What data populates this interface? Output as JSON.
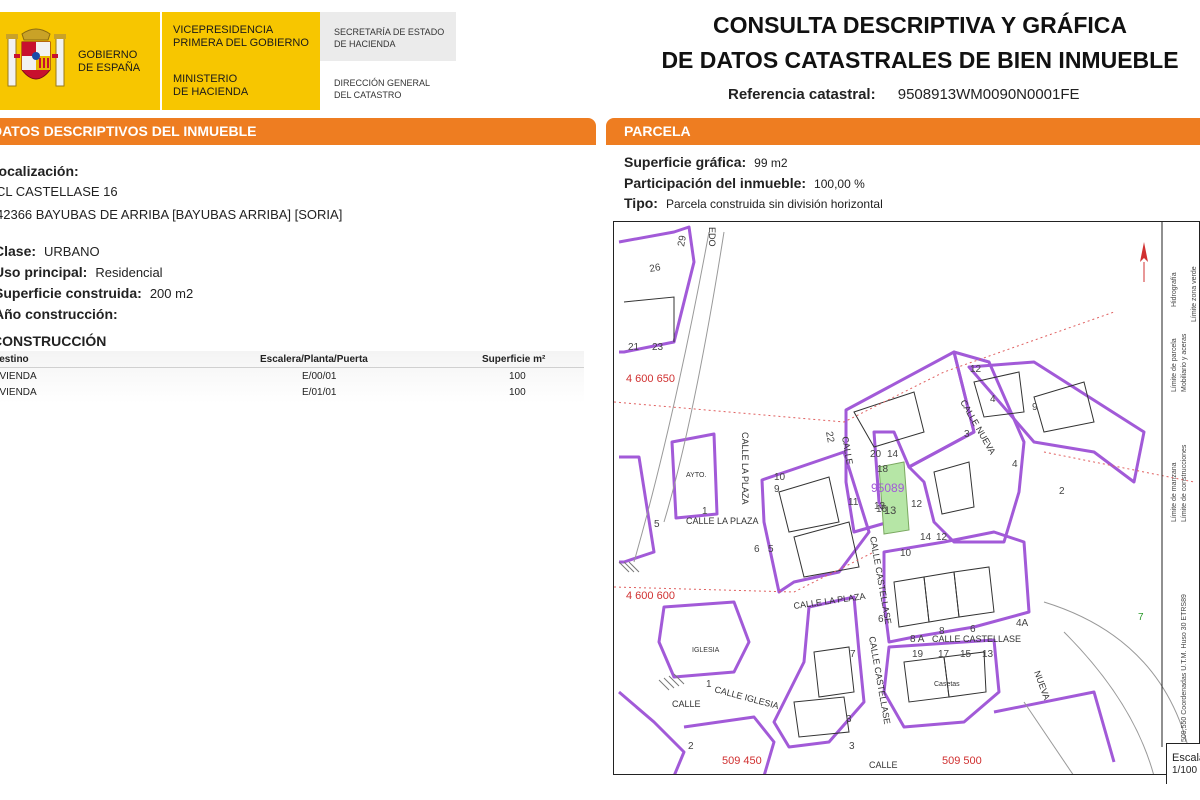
{
  "header": {
    "gobierno": "GOBIERNO\nDE ESPAÑA",
    "vicepresidencia": "VICEPRESIDENCIA\nPRIMERA DEL GOBIERNO",
    "ministerio": "MINISTERIO\nDE HACIENDA",
    "secretaria": "SECRETARÍA DE ESTADO\nDE HACIENDA",
    "direccion": "DIRECCIÓN GENERAL\nDEL CATASTRO",
    "title_line1": "CONSULTA DESCRIPTIVA Y GRÁFICA",
    "title_line2": "DE DATOS CATASTRALES DE BIEN INMUEBLE",
    "ref_label": "Referencia catastral:",
    "ref_value": "9508913WM0090N0001FE"
  },
  "descriptive": {
    "section_title": "DATOS DESCRIPTIVOS DEL INMUEBLE",
    "localizacion_label": "Localización:",
    "address_line1": "CL CASTELLASE 16",
    "address_line2": "42366 BAYUBAS DE ARRIBA [BAYUBAS ARRIBA] [SORIA]",
    "clase_label": "Clase:",
    "clase_value": "URBANO",
    "uso_label": "Uso principal:",
    "uso_value": "Residencial",
    "superficie_label": "Superficie construida:",
    "superficie_value": "200 m2",
    "ano_label": "Año construcción:",
    "ano_value": "",
    "construccion_title": "CONSTRUCCIÓN",
    "table": {
      "headers": [
        "Destino",
        "Escalera/Planta/Puerta",
        "Superficie m²"
      ],
      "rows": [
        [
          "VIVIENDA",
          "E/00/01",
          "100"
        ],
        [
          "VIVIENDA",
          "E/01/01",
          "100"
        ]
      ]
    }
  },
  "parcela": {
    "section_title": "PARCELA",
    "sup_label": "Superficie gráfica:",
    "sup_value": "99 m2",
    "part_label": "Participación del inmueble:",
    "part_value": "100,00 %",
    "tipo_label": "Tipo:",
    "tipo_value": "Parcela construida sin división horizontal"
  },
  "map": {
    "parcel_id": "95089",
    "parcel_number": "13",
    "coord_labels": [
      "4 600 650",
      "4 600 600",
      "509 450",
      "509 500"
    ],
    "street_labels": [
      "CALLE LA PLAZA",
      "CALLE LA PLAZA",
      "CALLE LA PLAZA",
      "CALLE CASTELLASE",
      "CALLE CASTELLASE",
      "CALLE CASTELLASE",
      "CALLE IGLESIA",
      "CALLE",
      "CALLE NUEVA",
      "NUEVA",
      "CALLE",
      "EDO",
      "CALLE"
    ],
    "building_labels": [
      "AYTO.",
      "IGLESIA",
      "Casetas"
    ],
    "numbers": [
      "29",
      "26",
      "21",
      "23",
      "14",
      "20",
      "18",
      "13",
      "12",
      "16",
      "11",
      "10",
      "14",
      "12",
      "19",
      "9",
      "8",
      "6",
      "5",
      "4",
      "3",
      "2",
      "1",
      "22",
      "17",
      "15",
      "13",
      "8 A",
      "4A",
      "5",
      "6",
      "7",
      "3",
      "6",
      "7",
      "1",
      "2",
      "3",
      "9",
      "10",
      "12",
      "4"
    ],
    "legend_items": [
      "Límite de manzana",
      "Límite de parcela",
      "Límite de construcciones",
      "Mobiliario y aceras",
      "Límite zona verde",
      "Hidrografía"
    ],
    "coord_note": "509,550 Coordenadas U.T.M. Huso 30 ETRS89",
    "scale_label": "Escala",
    "scale_value": "1/100"
  },
  "colors": {
    "orange_bar": "#ee7d21",
    "yellow_header": "#f7c600",
    "parcel_outline": "#a25ad8",
    "parcel_fill": "#b6e6a6",
    "coord_text": "#d03030"
  }
}
